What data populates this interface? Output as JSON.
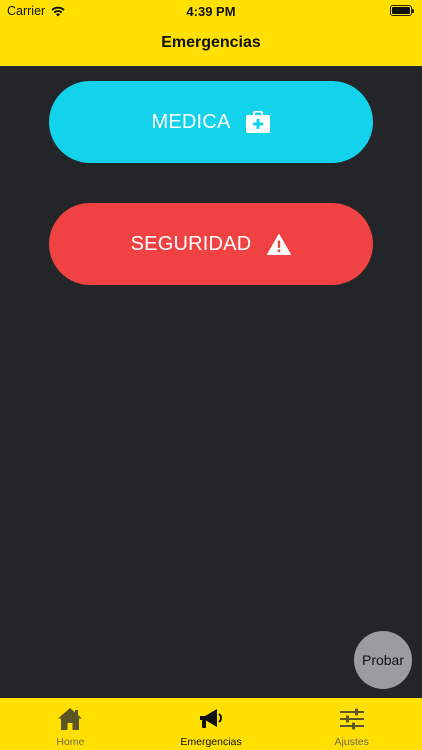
{
  "status_bar": {
    "carrier": "Carrier",
    "time": "4:39 PM"
  },
  "nav": {
    "title": "Emergencias"
  },
  "buttons": {
    "medica": {
      "label": "MEDICA",
      "icon": "first-aid-kit-icon",
      "color": "#12d2ec"
    },
    "seguridad": {
      "label": "SEGURIDAD",
      "icon": "warning-triangle-icon",
      "color": "#f04242"
    }
  },
  "fab": {
    "label": "Probar"
  },
  "tabs": [
    {
      "label": "Home",
      "icon": "home-icon"
    },
    {
      "label": "Emergencias",
      "icon": "megaphone-icon"
    },
    {
      "label": "Ajustes",
      "icon": "sliders-icon"
    }
  ],
  "colors": {
    "accent": "#ffe000",
    "background": "#242529"
  }
}
